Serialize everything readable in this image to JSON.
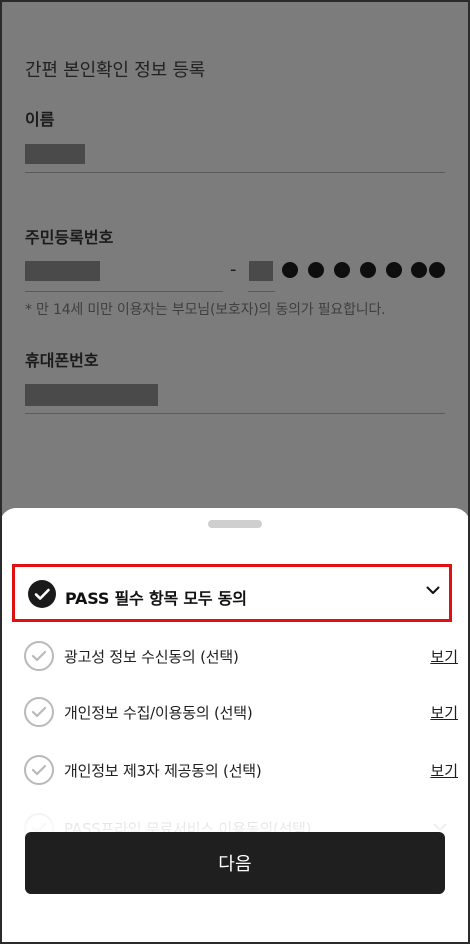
{
  "background_form": {
    "title": "간편 본인확인 정보 등록",
    "name_label": "이름",
    "resident_label": "주민등록번호",
    "resident_separator": "-",
    "resident_masked_dots": 7,
    "resident_hint": "* 만 14세 미만 이용자는 부모님(보호자)의 동의가 필요합니다.",
    "phone_label": "휴대폰번호"
  },
  "sheet": {
    "all_agree_label": "PASS 필수 항목 모두 동의",
    "items": [
      {
        "label": "광고성 정보 수신동의 (선택)",
        "link": "보기"
      },
      {
        "label": "개인정보 수집/이용동의 (선택)",
        "link": "보기"
      },
      {
        "label": "개인정보 제3자 제공동의 (선택)",
        "link": "보기"
      },
      {
        "label": "PASS프라임 무료서비스 이용동의(선택)"
      }
    ],
    "next_button": "다음"
  },
  "colors": {
    "highlight_border": "#e01010",
    "button_bg": "#1f1f1f",
    "overlay_bg": "#7c7c7c"
  },
  "icons": {
    "check_filled": "check-circle-filled-icon",
    "check_outline": "check-circle-outline-icon",
    "chevron": "chevron-down-icon"
  }
}
